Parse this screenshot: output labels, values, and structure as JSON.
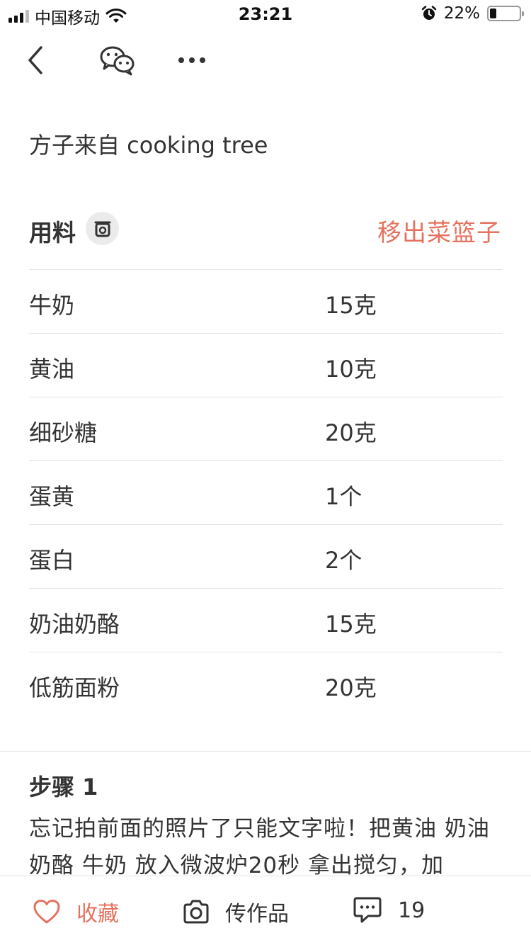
{
  "status_bar": {
    "carrier": "中国移动",
    "time": "23:21",
    "battery_percent": "22%",
    "battery_level": 0.22,
    "icons": [
      "signal-icon",
      "wifi-icon",
      "alarm-icon",
      "battery-icon"
    ]
  },
  "nav": {
    "icons": [
      "back-icon",
      "wechat-icon",
      "more-icon"
    ]
  },
  "recipe": {
    "source": "方子来自 cooking tree"
  },
  "ingredients": {
    "title": "用料",
    "scale_icon": "kitchen-scale-icon",
    "remove_label": "移出菜篮子",
    "items": [
      {
        "name": "牛奶",
        "qty": "15克"
      },
      {
        "name": "黄油",
        "qty": "10克"
      },
      {
        "name": "细砂糖",
        "qty": "20克"
      },
      {
        "name": "蛋黄",
        "qty": "1个"
      },
      {
        "name": "蛋白",
        "qty": "2个"
      },
      {
        "name": "奶油奶酪",
        "qty": "15克"
      },
      {
        "name": "低筋面粉",
        "qty": "20克"
      }
    ]
  },
  "step": {
    "title": "步骤 1",
    "text": "忘记拍前面的照片了只能文字啦！把黄油 奶油奶酪 牛奶 放入微波炉20秒 拿出搅匀，加"
  },
  "bottom_bar": {
    "favorite_label": "收藏",
    "upload_label": "传作品",
    "comment_count": "19",
    "accent_color": "#e5725f"
  }
}
